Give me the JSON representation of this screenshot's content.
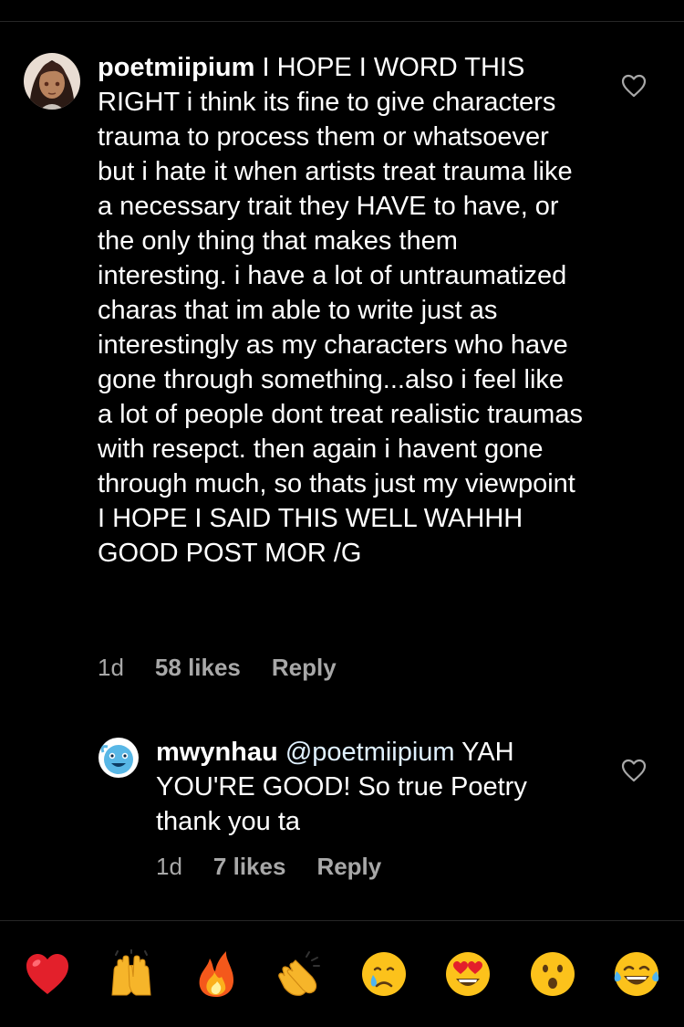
{
  "comments": [
    {
      "username": "poetmiipium",
      "text": "I HOPE I WORD THIS RIGHT i think its fine to give characters trauma to process them or whatsoever but i hate it when artists treat trauma like a necessary trait they HAVE to have, or the only thing that makes them interesting. i have a lot of untraumatized charas that im able to write just as interestingly as my characters who have gone through something...also i feel like a lot of people dont treat realistic traumas with resepct. then again i havent gone through much, so thats just my viewpoint I HOPE I SAID THIS WELL WAHHH GOOD POST MOR /G",
      "time": "1d",
      "likes": "58 likes",
      "reply": "Reply",
      "avatar_icon": "anime-character-avatar"
    },
    {
      "username": "mwynhau",
      "mention": "@poetmiipium",
      "text": "YAH YOU'RE GOOD! So true Poetry thank you ta",
      "time": "1d",
      "likes": "7 likes",
      "reply": "Reply",
      "avatar_icon": "blue-creature-avatar"
    }
  ],
  "reactions": [
    "❤️",
    "🙌",
    "🔥",
    "👏",
    "😢",
    "😍",
    "😮",
    "😂"
  ],
  "colors": {
    "background": "#000000",
    "text": "#ffffff",
    "meta": "#a8a8a8",
    "divider": "#262626",
    "mention": "#e0f1ff"
  }
}
